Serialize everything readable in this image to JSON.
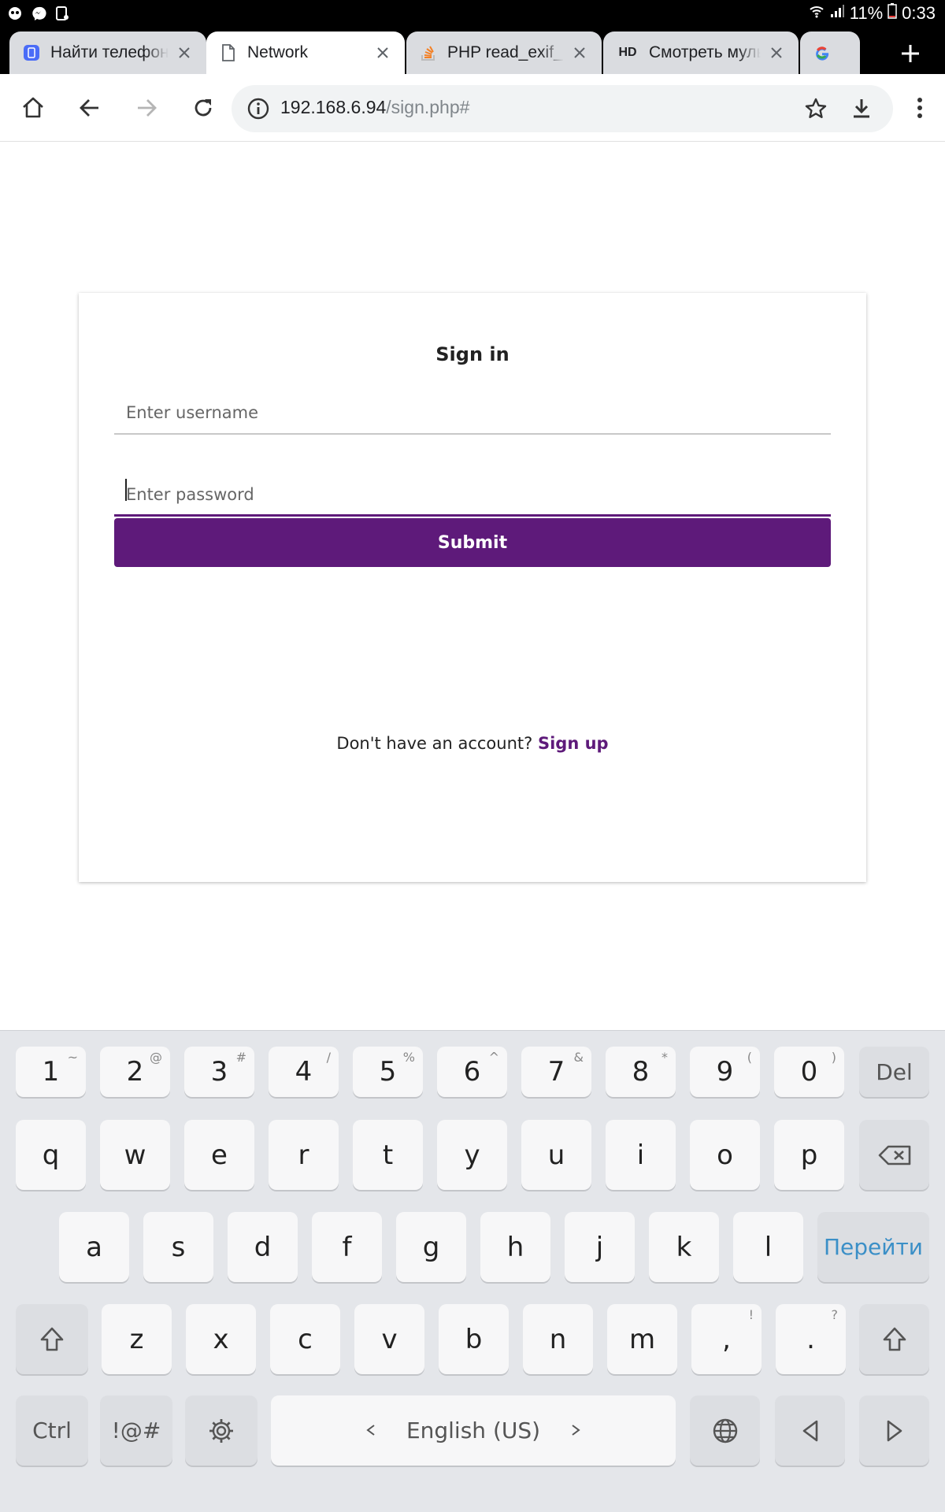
{
  "status_bar": {
    "battery": "11%",
    "time": "0:33"
  },
  "tabs": [
    {
      "title": "Найти телефон",
      "active": false,
      "favicon": "find-phone-icon"
    },
    {
      "title": "Network",
      "active": true,
      "favicon": "document-icon"
    },
    {
      "title": "PHP read_exif_d",
      "active": false,
      "favicon": "stackoverflow-icon"
    },
    {
      "title": "Смотреть мульт",
      "active": false,
      "favicon_text": "HD"
    },
    {
      "title": "",
      "active": false,
      "favicon": "google-icon"
    }
  ],
  "omnibox": {
    "host": "192.168.6.94",
    "path": "/sign.php#"
  },
  "form": {
    "title": "Sign in",
    "username_placeholder": "Enter username",
    "password_placeholder": "Enter password",
    "submit_label": "Submit",
    "signup_prompt": "Don't have an account? ",
    "signup_link": "Sign up"
  },
  "colors": {
    "accent": "#5e1a7a",
    "go_key": "#3b8fc7"
  },
  "keyboard": {
    "row1": [
      {
        "k": "1",
        "s": "~"
      },
      {
        "k": "2",
        "s": "@"
      },
      {
        "k": "3",
        "s": "#"
      },
      {
        "k": "4",
        "s": "/"
      },
      {
        "k": "5",
        "s": "%"
      },
      {
        "k": "6",
        "s": "^"
      },
      {
        "k": "7",
        "s": "&"
      },
      {
        "k": "8",
        "s": "*"
      },
      {
        "k": "9",
        "s": "("
      },
      {
        "k": "0",
        "s": ")"
      }
    ],
    "del_label": "Del",
    "row2": [
      "q",
      "w",
      "e",
      "r",
      "t",
      "y",
      "u",
      "i",
      "o",
      "p"
    ],
    "row3": [
      "a",
      "s",
      "d",
      "f",
      "g",
      "h",
      "j",
      "k",
      "l"
    ],
    "go_label": "Перейти",
    "row4": [
      {
        "k": "z"
      },
      {
        "k": "x"
      },
      {
        "k": "c"
      },
      {
        "k": "v"
      },
      {
        "k": "b"
      },
      {
        "k": "n"
      },
      {
        "k": "m"
      },
      {
        "k": ",",
        "s": "!"
      },
      {
        "k": ".",
        "s": "?"
      }
    ],
    "ctrl_label": "Ctrl",
    "symbols_label": "!@#",
    "space_label": "English (US)"
  }
}
